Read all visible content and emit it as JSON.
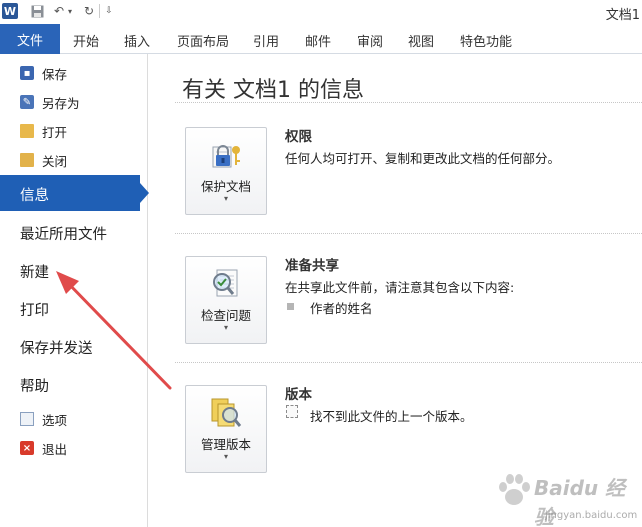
{
  "window": {
    "app_icon_letter": "W",
    "doc_title": "文档1"
  },
  "ribbon": {
    "file_tab": "文件",
    "tabs": [
      "开始",
      "插入",
      "页面布局",
      "引用",
      "邮件",
      "审阅",
      "视图",
      "特色功能"
    ]
  },
  "backstage_nav": {
    "small_items": [
      {
        "label": "保存",
        "icon": "save-icon"
      },
      {
        "label": "另存为",
        "icon": "save-as-icon"
      },
      {
        "label": "打开",
        "icon": "open-folder-icon"
      },
      {
        "label": "关闭",
        "icon": "close-folder-icon"
      }
    ],
    "active_item": "信息",
    "big_items": [
      "最近所用文件",
      "新建",
      "打印",
      "保存并发送",
      "帮助"
    ],
    "bottom_items": [
      {
        "label": "选项",
        "icon": "options-icon"
      },
      {
        "label": "退出",
        "icon": "exit-icon"
      }
    ]
  },
  "info_page": {
    "title": "有关 文档1 的信息",
    "sections": [
      {
        "button_label": "保护文档",
        "heading": "权限",
        "description": "任何人均可打开、复制和更改此文档的任何部分。"
      },
      {
        "button_label": "检查问题",
        "heading": "准备共享",
        "description": "在共享此文件前，请注意其包含以下内容:",
        "bullets": [
          "作者的姓名"
        ]
      },
      {
        "button_label": "管理版本",
        "heading": "版本",
        "description": "找不到此文件的上一个版本。"
      }
    ]
  },
  "watermark": {
    "brand": "Baidu 经验",
    "url": "jingyan.baidu.com"
  },
  "colors": {
    "accent_blue": "#2a64b8",
    "annotation_red": "#e04b4b"
  }
}
